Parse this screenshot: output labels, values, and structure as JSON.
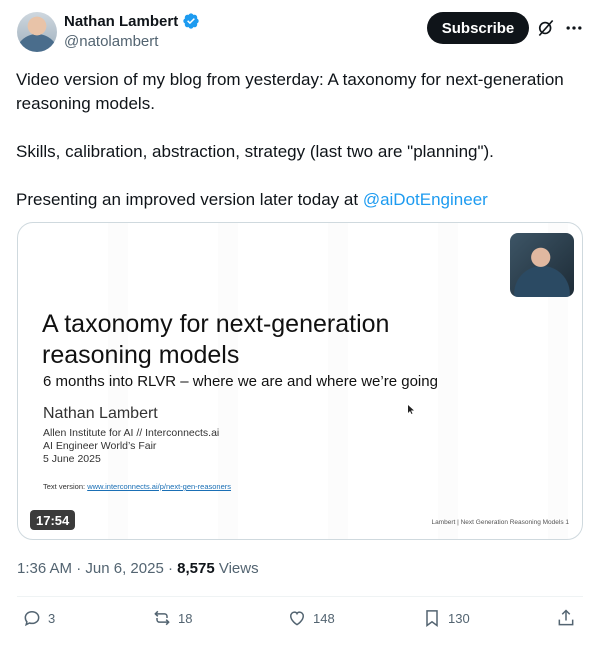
{
  "author": {
    "display_name": "Nathan Lambert",
    "handle": "@natolambert",
    "verified_color": "#1d9bf0"
  },
  "header": {
    "subscribe_label": "Subscribe",
    "icons": [
      "grok-icon",
      "more-icon"
    ]
  },
  "tweet": {
    "paragraph_1": "Video version of my blog from yesterday: A taxonomy for next-generation reasoning models.",
    "paragraph_2": "Skills, calibration, abstraction, strategy (last two are \"planning\").",
    "paragraph_3_prefix": "Presenting an improved version later today at ",
    "mention": "@aiDotEngineer"
  },
  "video": {
    "slide_title": "A taxonomy for next-generation reasoning models",
    "slide_subtitle": "6 months into RLVR – where we are and where we’re going",
    "slide_author": "Nathan Lambert",
    "slide_affiliation_1": "Allen Institute for AI // Interconnects.ai",
    "slide_affiliation_2": "AI Engineer World’s Fair",
    "slide_affiliation_3": "5 June 2025",
    "slide_textversion_prefix": "Text version: ",
    "slide_textversion_link": "www.interconnects.ai/p/next-gen-reasoners",
    "slide_footer": "Lambert | Next Generation Reasoning Models  1",
    "duration": "17:54"
  },
  "meta": {
    "time": "1:36 AM",
    "date": "Jun 6, 2025",
    "views_count": "8,575",
    "views_label": "Views"
  },
  "actions": {
    "replies": "3",
    "reposts": "18",
    "likes": "148",
    "bookmarks": "130"
  },
  "colors": {
    "text": "#0f1419",
    "secondary": "#536471",
    "accent": "#1d9bf0"
  }
}
